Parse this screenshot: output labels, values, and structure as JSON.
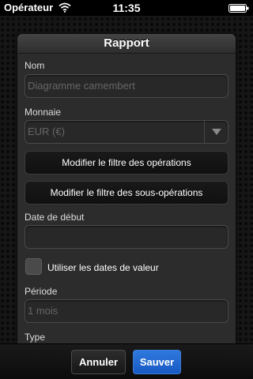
{
  "status_bar": {
    "carrier": "Opérateur",
    "time": "11:35",
    "icons": [
      "wifi-icon",
      "battery-icon"
    ]
  },
  "dialog": {
    "title": "Rapport",
    "name": {
      "label": "Nom",
      "placeholder": "Diagramme camembert"
    },
    "currency": {
      "label": "Monnaie",
      "selected": "EUR (€)"
    },
    "buttons": {
      "filter_operations": "Modifier le filtre des opérations",
      "filter_suboperations": "Modifier le filtre des sous-opérations"
    },
    "start_date": {
      "label": "Date de début",
      "value": ""
    },
    "value_dates": {
      "label": "Utiliser les dates de valeur",
      "checked": false
    },
    "period": {
      "label": "Période",
      "placeholder": "1 mois"
    },
    "type": {
      "label": "Type"
    }
  },
  "toolbar": {
    "cancel_label": "Annuler",
    "save_label": "Sauver"
  },
  "colors": {
    "save_button": "#1f66d1",
    "background": "#161616",
    "panel": "#2c2c2c"
  }
}
